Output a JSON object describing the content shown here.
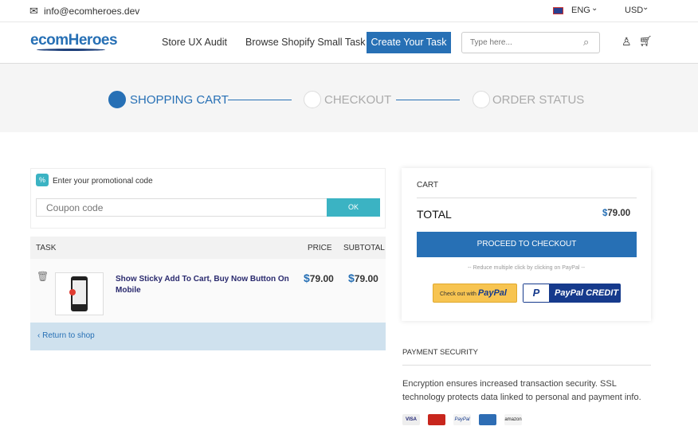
{
  "topbar": {
    "email": "info@ecomheroes.dev",
    "language": "ENG",
    "currency": "USD"
  },
  "nav": {
    "logo": "ecomHeroes",
    "links": [
      "Store UX Audit",
      "Browse Shopify Small Task"
    ],
    "cta": "Create Your Task",
    "search_placeholder": "Type here..."
  },
  "steps": [
    {
      "label": "SHOPPING CART",
      "active": true
    },
    {
      "label": "CHECKOUT",
      "active": false
    },
    {
      "label": "ORDER STATUS",
      "active": false
    }
  ],
  "promo": {
    "label": "Enter your promotional code",
    "placeholder": "Coupon code",
    "button": "OK"
  },
  "table": {
    "headers": {
      "task": "TASK",
      "price": "PRICE",
      "subtotal": "SUBTOTAL"
    },
    "rows": [
      {
        "name": "Show Sticky Add To Cart, Buy Now Button On Mobile",
        "currency": "$",
        "price": "79.00",
        "subtotal": "79.00"
      }
    ],
    "return": "Return to shop"
  },
  "cart": {
    "title": "CART",
    "total_label": "TOTAL",
    "currency": "$",
    "total": "79.00",
    "checkout": "PROCEED TO CHECKOUT",
    "note": "-- Reduce multiple click by clicking on PayPal --",
    "paypal_prefix": "Check out with",
    "paypal": "PayPal",
    "paypal_credit": "PayPal CREDIT"
  },
  "security": {
    "title": "PAYMENT SECURITY",
    "text": "Encryption ensures increased transaction security. SSL technology protects data linked to personal and payment info.",
    "icons": [
      "VISA",
      "MasterCard",
      "PayPal",
      "American Express",
      "amazon"
    ]
  },
  "colors": {
    "primary": "#2770b5",
    "teal": "#3bb3c3",
    "step_bg": "#f5f5f5",
    "return_bg": "#cfe1ee",
    "paypal_yellow": "#f7c451",
    "paypal_navy": "#163a8c"
  }
}
